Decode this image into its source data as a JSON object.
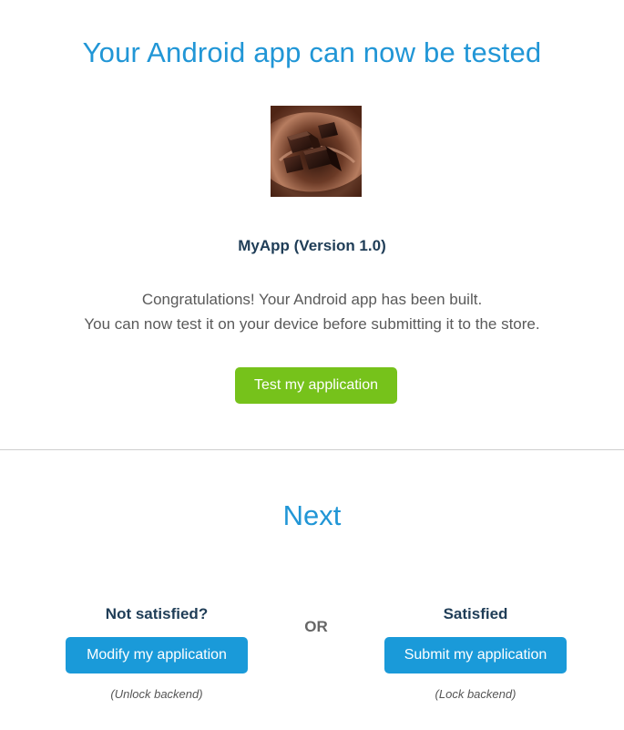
{
  "header": {
    "title": "Your Android app can now be tested"
  },
  "app": {
    "icon": "chocolate-app-icon",
    "name": "MyApp (Version 1.0)",
    "message_line1": "Congratulations! Your Android app has been built.",
    "message_line2": "You can now test it on your device before submitting it to the store.",
    "test_button_label": "Test my application"
  },
  "next": {
    "title": "Next",
    "or_label": "OR",
    "left": {
      "heading": "Not satisfied?",
      "button_label": "Modify my application",
      "note": "(Unlock backend)"
    },
    "right": {
      "heading": "Satisfied",
      "button_label": "Submit my application",
      "note": "(Lock backend)"
    }
  },
  "colors": {
    "title": "#2196d6",
    "test_button": "#76c21b",
    "action_button": "#1a9ad9",
    "heading_dark": "#1f3d57"
  }
}
